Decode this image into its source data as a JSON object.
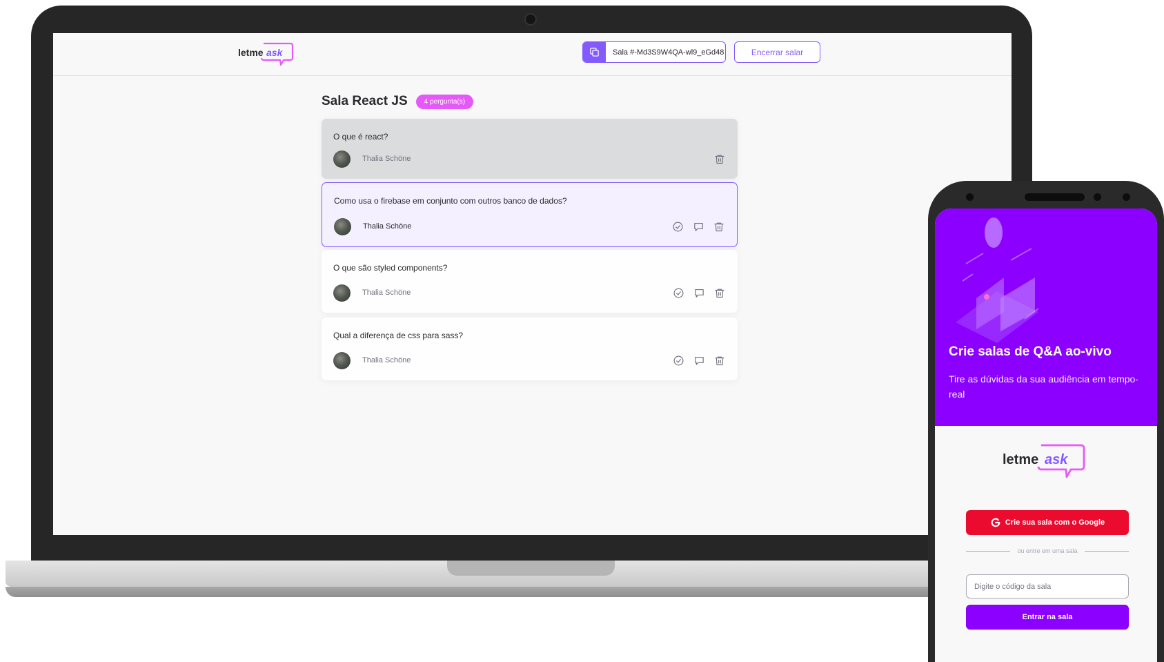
{
  "desktop": {
    "logo": {
      "text_main": "letme",
      "text_accent": "ask"
    },
    "room_code": {
      "label": "Sala #-Md3S9W4QA-wl9_eGd48"
    },
    "end_room_label": "Encerrar salar",
    "room": {
      "title": "Sala React JS",
      "question_count_label": "4 pergunta(s)"
    },
    "questions": [
      {
        "content": "O que é react?",
        "author": "Thalia Schöne",
        "state": "answered"
      },
      {
        "content": "Como usa o firebase em conjunto com outros banco de dados?",
        "author": "Thalia Schöne",
        "state": "highlighted"
      },
      {
        "content": "O que são styled components?",
        "author": "Thalia Schöne",
        "state": "default"
      },
      {
        "content": "Qual a diferença de css para sass?",
        "author": "Thalia Schöne",
        "state": "default"
      }
    ]
  },
  "mobile": {
    "hero": {
      "title": "Crie salas de Q&A ao-vivo",
      "subtitle": "Tire as dúvidas da sua audiência em tempo-real"
    },
    "logo": {
      "text_main": "letme",
      "text_accent": "ask"
    },
    "google_button_label": "Crie sua sala com o Google",
    "separator_label": "ou entre em uma sala",
    "room_input": {
      "placeholder": "Digite o código da sala",
      "value": ""
    },
    "enter_button_label": "Entrar na sala"
  },
  "colors": {
    "brand_purple": "#835afd",
    "accent_pink": "#e559f9",
    "hero_purple": "#8b00ff",
    "google_red": "#ea0b2e",
    "text_dark": "#29292e",
    "text_muted": "#737380"
  },
  "icons": {
    "copy": "copy-icon",
    "check": "check-circle-icon",
    "answer": "chat-bubble-icon",
    "delete": "trash-icon",
    "google": "google-icon"
  }
}
